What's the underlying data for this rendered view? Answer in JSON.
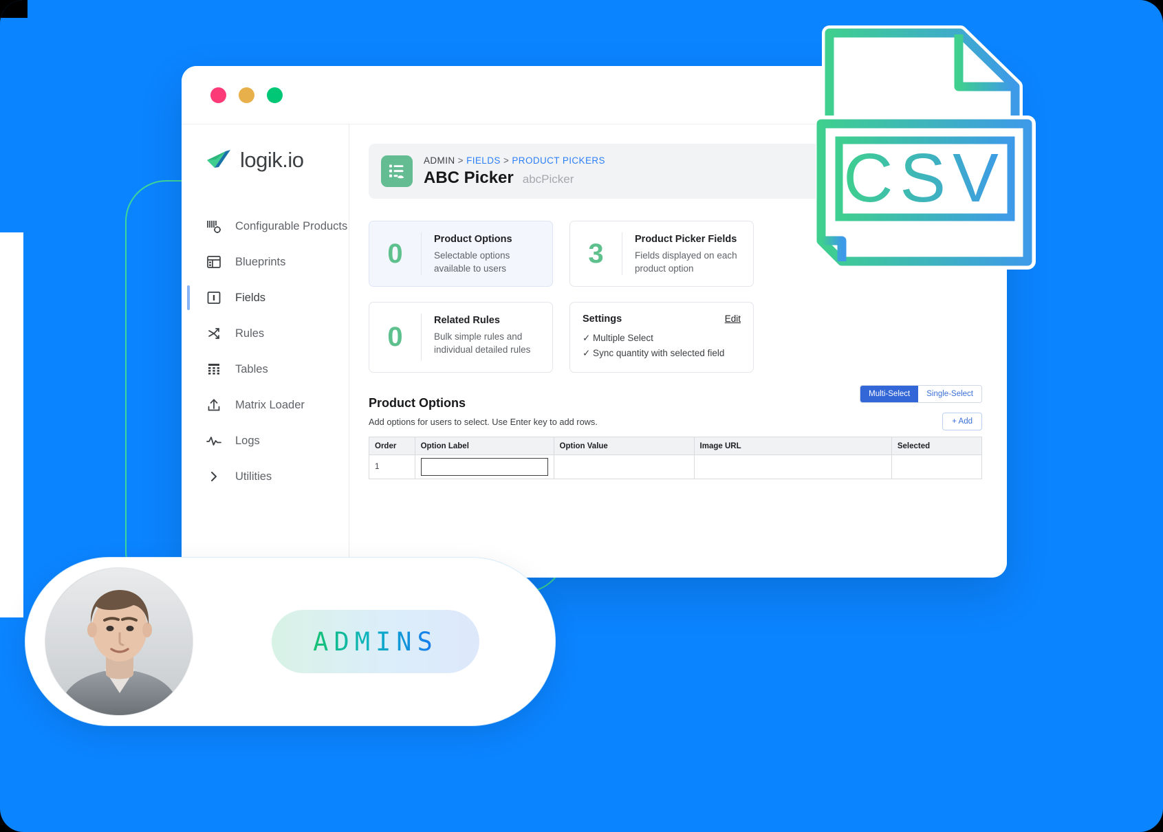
{
  "window": {
    "dots": [
      {
        "name": "close-dot",
        "color": "#fb3a77"
      },
      {
        "name": "minimize-dot",
        "color": "#e8b04b"
      },
      {
        "name": "maximize-dot",
        "color": "#00c776"
      }
    ]
  },
  "brand": {
    "logo_text": "logik.io",
    "logo_icon": "paper-plane-icon"
  },
  "sidebar": {
    "items": [
      {
        "label": "Configurable Products",
        "icon": "configurable-products-icon",
        "active": false
      },
      {
        "label": "Blueprints",
        "icon": "blueprints-icon",
        "active": false
      },
      {
        "label": "Fields",
        "icon": "fields-icon",
        "active": true
      },
      {
        "label": "Rules",
        "icon": "rules-icon",
        "active": false
      },
      {
        "label": "Tables",
        "icon": "tables-icon",
        "active": false
      },
      {
        "label": "Matrix Loader",
        "icon": "upload-icon",
        "active": false
      },
      {
        "label": "Logs",
        "icon": "activity-icon",
        "active": false
      },
      {
        "label": "Utilities",
        "icon": "chevron-right-icon",
        "active": false
      }
    ]
  },
  "header": {
    "icon": "list-picker-icon",
    "breadcrumb": {
      "root": "ADMIN",
      "sep1": ">",
      "level1": "FIELDS",
      "sep2": ">",
      "level2": "PRODUCT PICKERS"
    },
    "title": "ABC Picker",
    "api_name": "abcPicker"
  },
  "cards": [
    {
      "value": "0",
      "title": "Product Options",
      "desc": "Selectable options available to users",
      "highlight": true
    },
    {
      "value": "3",
      "title": "Product Picker Fields",
      "desc": "Fields displayed on each product option",
      "highlight": false
    },
    {
      "value": "0",
      "title": "Related Rules",
      "desc": "Bulk simple rules and individual detailed rules",
      "highlight": false
    }
  ],
  "settings_card": {
    "title": "Settings",
    "edit_label": "Edit",
    "lines": [
      "✓ Multiple Select",
      "✓ Sync quantity with selected field"
    ]
  },
  "product_options": {
    "title": "Product Options",
    "subtitle": "Add options for users to select. Use Enter key to add rows.",
    "segmented": {
      "multi": "Multi-Select",
      "single": "Single-Select",
      "active": "Multi-Select"
    },
    "add_label": "+ Add",
    "columns": [
      "Order",
      "Option Label",
      "Option Value",
      "Image URL",
      "Selected"
    ],
    "rows": [
      {
        "order": "1",
        "option_label": "",
        "option_value": "",
        "image_url": "",
        "selected": ""
      }
    ]
  },
  "csv_badge": {
    "label": "CSV",
    "icon": "csv-file-icon",
    "gradient_start": "#3fcf8e",
    "gradient_end": "#3d9ae8"
  },
  "admins": {
    "label": "ADMINS",
    "avatar": "user-photo-avatar"
  },
  "colors": {
    "page_background": "#0B84FF",
    "accent_green": "#5ec08d",
    "accent_blue": "#3366d6",
    "link_blue": "#2d7ff9"
  }
}
